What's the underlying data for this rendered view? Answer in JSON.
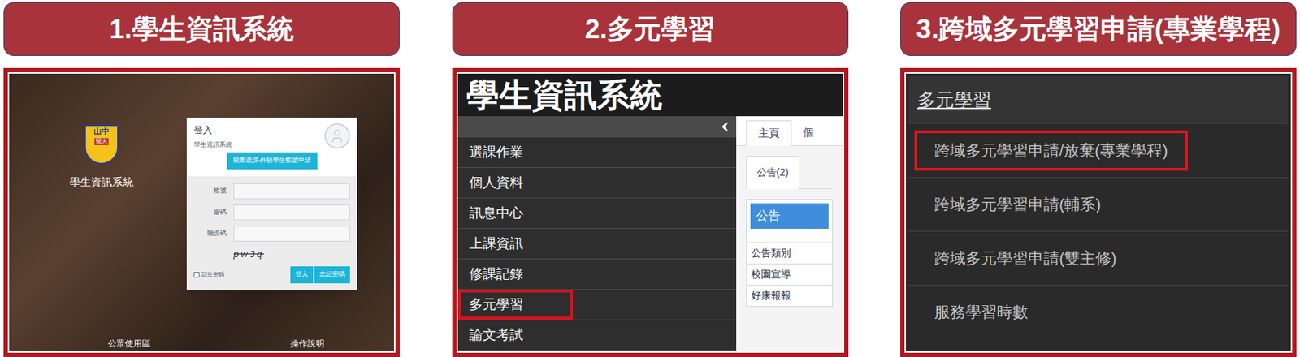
{
  "steps": [
    {
      "title": "1.學生資訊系統",
      "kind": "login"
    },
    {
      "title": "2.多元學習",
      "kind": "portal"
    },
    {
      "title": "3.跨域多元學習申請(專業學程)",
      "kind": "menu"
    }
  ],
  "login": {
    "logo": {
      "top": "山中",
      "bottom": "醫大"
    },
    "site_label": "學生資訊系統",
    "card": {
      "title": "登入",
      "subtitle": "學生資訊系統",
      "apply_button": "校際選課-外校學生帳號申請",
      "fields": [
        {
          "label": "帳號"
        },
        {
          "label": "密碼"
        },
        {
          "label": "驗證碼"
        }
      ],
      "captcha": "pw3q",
      "remember": {
        "label": "記住密碼",
        "checked": false
      },
      "buttons": [
        "登入",
        "忘記密碼"
      ]
    },
    "footer_links": [
      "公眾使用區",
      "操作說明"
    ]
  },
  "portal": {
    "title": "學生資訊系統",
    "sidebar": [
      {
        "label": "選課作業",
        "highlighted": false
      },
      {
        "label": "個人資料",
        "highlighted": false
      },
      {
        "label": "訊息中心",
        "highlighted": false
      },
      {
        "label": "上課資訊",
        "highlighted": false
      },
      {
        "label": "修課記錄",
        "highlighted": false
      },
      {
        "label": "多元學習",
        "highlighted": true
      },
      {
        "label": "論文考試",
        "highlighted": false
      }
    ],
    "tabs": [
      {
        "label": "主頁",
        "selected": true
      },
      {
        "label": "個",
        "selected": false
      }
    ],
    "sub_tabs": [
      {
        "label": "公告(2)",
        "selected": true
      }
    ],
    "panel_title": "公告",
    "rows": [
      "公告類別",
      "校園宣導",
      "好康報報"
    ]
  },
  "menu": {
    "title": "多元學習",
    "items": [
      {
        "label": "跨域多元學習申請/放棄(專業學程)",
        "highlighted": true
      },
      {
        "label": "跨域多元學習申請(輔系)",
        "highlighted": false
      },
      {
        "label": "跨域多元學習申請(雙主修)",
        "highlighted": false
      },
      {
        "label": "服務學習時數",
        "highlighted": false
      }
    ]
  }
}
